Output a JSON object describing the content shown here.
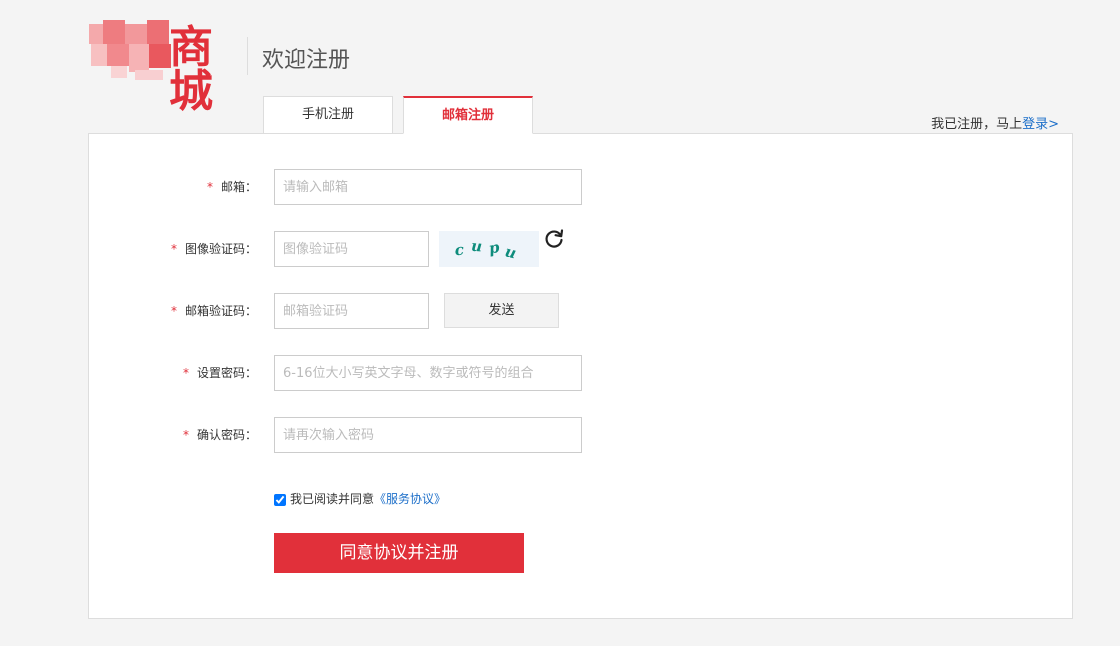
{
  "header": {
    "logo_text": "商城",
    "welcome": "欢迎注册"
  },
  "tabs": [
    {
      "label": "手机注册",
      "active": false
    },
    {
      "label": "邮箱注册",
      "active": true
    }
  ],
  "login_hint": {
    "text": "我已注册，马上",
    "link": "登录>"
  },
  "form": {
    "email": {
      "label": "邮箱：",
      "placeholder": "请输入邮箱"
    },
    "image_code": {
      "label": "图像验证码：",
      "placeholder": "图像验证码",
      "captcha_text": "cupu"
    },
    "email_code": {
      "label": "邮箱验证码：",
      "placeholder": "邮箱验证码",
      "send_label": "发送"
    },
    "password": {
      "label": "设置密码：",
      "placeholder": "6-16位大小写英文字母、数字或符号的组合"
    },
    "confirm_password": {
      "label": "确认密码：",
      "placeholder": "请再次输入密码"
    },
    "required_mark": "*"
  },
  "agreement": {
    "checked": true,
    "text": "我已阅读并同意",
    "link": "《服务协议》"
  },
  "submit_label": "同意协议并注册",
  "colors": {
    "accent": "#e1303a",
    "link": "#1d6fc9"
  }
}
